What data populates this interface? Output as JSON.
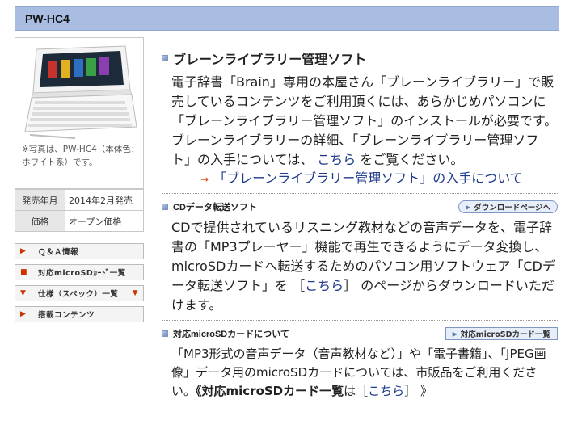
{
  "header": {
    "title": "PW-HC4"
  },
  "left": {
    "photo_note": "※写真は、PW-HC4（本体色：ホワイト系）です。",
    "spec_rows": [
      {
        "key": "発売年月",
        "value": "2014年2月発売"
      },
      {
        "key": "価格",
        "value": "オープン価格"
      }
    ],
    "nav": [
      {
        "mark": "▶",
        "label": "Ｑ＆Ａ情報",
        "mark_right": ""
      },
      {
        "mark": "■",
        "label": "対応microSDｶｰﾄﾞ一覧",
        "mark_right": ""
      },
      {
        "mark": "▼",
        "label": "仕様（スペック）一覧",
        "mark_right": "▼"
      },
      {
        "mark": "▶",
        "label": "搭載コンテンツ",
        "mark_right": ""
      }
    ]
  },
  "sec1": {
    "title": "ブレーンライブラリー管理ソフト",
    "p1": "電子辞書「Brain」専用の本屋さん「ブレーンライブラリー」で販売しているコンテンツをご利用頂くには、あらかじめパソコンに「ブレーンライブラリー管理ソフト」のインストールが必要です。",
    "p2_a": "ブレーンライブラリーの詳細、「ブレーンライブラリー管理ソフト」の入手については、",
    "p2_link": "こちら",
    "p2_b": "をご覧ください。",
    "link_arrow": "→",
    "link": "「ブレーンライブラリー管理ソフト」の入手について"
  },
  "sec2": {
    "title": "CDデータ転送ソフト",
    "button": "ダウンロードページへ",
    "p_a": "CDで提供されているリスニング教材などの音声データを、電子辞書の「MP3プレーヤー」機能で再生できるようにデータ変換し、 microSDカードへ転送するためのパソコン用ソフトウェア「CDデータ転送ソフト」を ［",
    "p_link": "こちら",
    "p_b": "］ のページからダウンロードいただけます。"
  },
  "sec3": {
    "title": "対応microSDカードについて",
    "button": "対応microSDカード一覧",
    "p_a": "「MP3形式の音声データ（音声教材など）」や「電子書籍」、「JPEG画像」データ用のmicroSDカードについては、市販品をご利用ください。",
    "p_bold": "《対応microSDカード一覧",
    "p_mid": "は［",
    "p_link": "こちら",
    "p_end": "］ 》"
  }
}
